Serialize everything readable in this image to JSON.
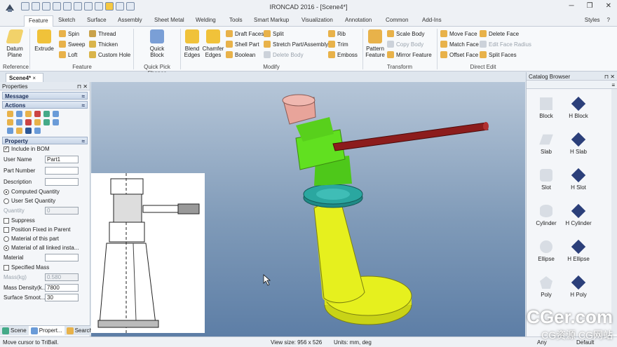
{
  "app": {
    "title": "IRONCAD 2016 - [Scene4*]",
    "styles": "Styles",
    "help": "?"
  },
  "tabs": [
    "Feature",
    "Sketch",
    "Surface",
    "Assembly",
    "Sheet Metal",
    "Welding",
    "Tools",
    "Smart Markup",
    "Visualization",
    "Annotation",
    "Common",
    "Add-Ins"
  ],
  "ribbon": {
    "datum": "Datum\nPlane",
    "extrude": "Extrude",
    "spin": "Spin",
    "sweep": "Sweep",
    "loft": "Loft",
    "thread": "Thread",
    "thicken": "Thicken",
    "custom_hole": "Custom Hole",
    "quick_block": "Quick\nBlock",
    "blend": "Blend\nEdges",
    "chamfer": "Chamfer\nEdges",
    "draft": "Draft Faces",
    "shell": "Shell Part",
    "boolean": "Boolean",
    "split": "Split",
    "stretch": "Stretch Part/Assembly",
    "delete_body": "Delete Body",
    "rib": "Rib",
    "trim": "Trim",
    "emboss": "Emboss",
    "pattern": "Pattern\nFeature",
    "scale_body": "Scale Body",
    "copy_body": "Copy Body",
    "mirror": "Mirror Feature",
    "move_face": "Move Face",
    "match_face": "Match Face",
    "offset_face": "Offset Face",
    "delete_face": "Delete Face",
    "edit_face_radius": "Edit Face Radius",
    "split_faces": "Split Faces",
    "groups": {
      "reference": "Reference",
      "feature": "Feature",
      "quick_pick": "Quick Pick Shapes",
      "modify": "Modify",
      "transform": "Transform",
      "direct_edit": "Direct Edit"
    }
  },
  "doc_tab": "Scene4*",
  "properties": {
    "title": "Properties",
    "message": "Message",
    "actions": "Actions",
    "property": "Property",
    "include_bom": "Include in BOM",
    "user_name_label": "User Name",
    "user_name": "Part1",
    "part_number": "Part Number",
    "description": "Description",
    "computed": "Computed Quantity",
    "user_set": "User Set Quantity",
    "quantity_label": "Quantity",
    "quantity": "0",
    "suppress": "Suppress",
    "position_fixed": "Position Fixed in Parent",
    "material_part": "Material of this part",
    "material_all": "Material of all linked insta...",
    "material": "Material",
    "specified_mass": "Specified Mass",
    "mass_label": "Mass(kg)",
    "mass": "0.580",
    "density_label": "Mass Density(k...",
    "density": "7800",
    "surface_label": "Surface Smoot...",
    "surface": "30"
  },
  "panel_tabs": [
    "Scene",
    "Propert...",
    "Search"
  ],
  "catalog": {
    "title": "Catalog Browser",
    "items": [
      "Block",
      "H Block",
      "Slab",
      "H Slab",
      "Slot",
      "H Slot",
      "Cylinder",
      "H Cylinder",
      "Ellipse",
      "H Ellipse",
      "Poly",
      "H Poly"
    ]
  },
  "status": {
    "hint": "Move cursor to TriBall.",
    "view_size": "View size: 956 x 526",
    "units": "Units: mm, deg",
    "any": "Any",
    "default": "Default"
  },
  "watermark": {
    "main": "CGer.com",
    "sub": "CG资源 CG网站"
  },
  "colors": {
    "cone": "#e6f01e",
    "collar": "#2aa7a0",
    "top": "#e8a49a",
    "handle": "#8c1c1c",
    "accent": "#2b5797"
  }
}
